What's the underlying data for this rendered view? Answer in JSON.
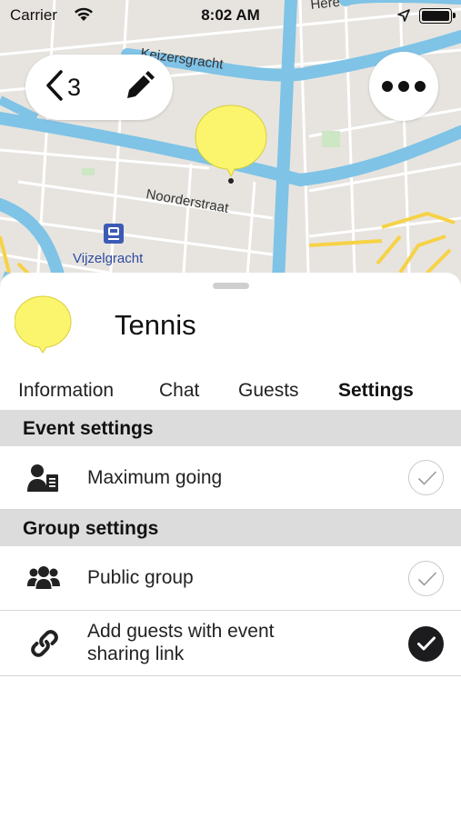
{
  "status_bar": {
    "carrier": "Carrier",
    "time": "8:02 AM"
  },
  "map": {
    "street_labels": {
      "keizersgracht": "Keizersgracht",
      "noorderstraat": "Noorderstraat",
      "vijzelgracht": "Vijzelgracht",
      "top_partial": "Here"
    },
    "colors": {
      "canal": "#7fc3e6",
      "land": "#e7e4df",
      "road": "#ffffff",
      "major_road": "#f6d246",
      "pin": "#fbf46d",
      "transit": "#3b5bb5"
    }
  },
  "map_controls": {
    "back_count": "3"
  },
  "event": {
    "title": "Tennis",
    "pin_color": "#fbf46d"
  },
  "tabs": [
    {
      "label": "Information",
      "active": false
    },
    {
      "label": "Chat",
      "active": false
    },
    {
      "label": "Guests",
      "active": false
    },
    {
      "label": "Settings",
      "active": true
    }
  ],
  "sections": {
    "event_settings": {
      "header": "Event settings",
      "rows": [
        {
          "label": "Maximum going",
          "icon": "user-list-icon",
          "checked": false
        }
      ]
    },
    "group_settings": {
      "header": "Group settings",
      "rows": [
        {
          "label": "Public group",
          "icon": "group-icon",
          "checked": false
        },
        {
          "label_line1": "Add guests with event",
          "label_line2": "sharing link",
          "icon": "link-icon",
          "checked": true
        }
      ]
    }
  }
}
